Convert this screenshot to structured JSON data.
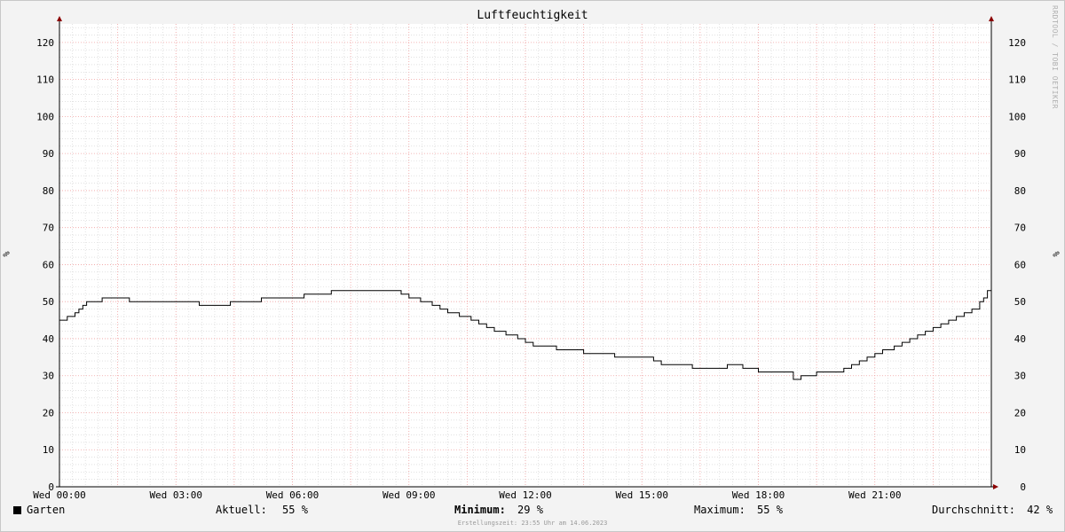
{
  "chart_data": {
    "type": "line",
    "title": "Luftfeuchtigkeit",
    "ylabel": "%",
    "ylim": [
      0,
      125
    ],
    "y_ticks": [
      0,
      10,
      20,
      30,
      40,
      50,
      60,
      70,
      80,
      90,
      100,
      110,
      120
    ],
    "x_range_hours": [
      0,
      24
    ],
    "x_tick_labels": [
      {
        "hour": 0,
        "label": "Wed 00:00"
      },
      {
        "hour": 3,
        "label": "Wed 03:00"
      },
      {
        "hour": 6,
        "label": "Wed 06:00"
      },
      {
        "hour": 9,
        "label": "Wed 09:00"
      },
      {
        "hour": 12,
        "label": "Wed 12:00"
      },
      {
        "hour": 15,
        "label": "Wed 15:00"
      },
      {
        "hour": 18,
        "label": "Wed 18:00"
      },
      {
        "hour": 21,
        "label": "Wed 21:00"
      }
    ],
    "grid": true,
    "series": [
      {
        "name": "Garten",
        "color": "#000000",
        "x": [
          0,
          0.1,
          0.2,
          0.3,
          0.4,
          0.5,
          0.6,
          0.7,
          1.0,
          1.1,
          1.7,
          1.8,
          2.7,
          3.6,
          4.4,
          5.2,
          6.3,
          7.0,
          8.0,
          8.6,
          8.8,
          9.0,
          9.3,
          9.6,
          9.8,
          10.0,
          10.3,
          10.6,
          10.8,
          11.0,
          11.2,
          11.5,
          11.8,
          12.0,
          12.2,
          12.8,
          13.5,
          14.3,
          14.9,
          15.3,
          15.5,
          16.3,
          17.2,
          17.6,
          18.0,
          18.9,
          19.1,
          19.5,
          20.0,
          20.2,
          20.4,
          20.6,
          20.8,
          21.0,
          21.2,
          21.5,
          21.7,
          21.9,
          22.1,
          22.3,
          22.5,
          22.7,
          22.9,
          23.1,
          23.3,
          23.5,
          23.7,
          23.8,
          23.9,
          24.0
        ],
        "y": [
          45,
          45,
          46,
          46,
          47,
          48,
          49,
          50,
          50,
          51,
          51,
          50,
          50,
          49,
          50,
          51,
          52,
          53,
          53,
          53,
          52,
          51,
          50,
          49,
          48,
          47,
          46,
          45,
          44,
          43,
          42,
          41,
          40,
          39,
          38,
          37,
          36,
          35,
          35,
          34,
          33,
          32,
          33,
          32,
          31,
          29,
          30,
          31,
          31,
          32,
          33,
          34,
          35,
          36,
          37,
          38,
          39,
          40,
          41,
          42,
          43,
          44,
          45,
          46,
          47,
          48,
          50,
          51,
          53,
          55
        ]
      }
    ]
  },
  "legend": {
    "series_name": "Garten",
    "current_label": "Aktuell:",
    "current_value": "55 %",
    "min_label": "Minimum:",
    "min_value": "29 %",
    "max_label": "Maximum:",
    "max_value": "55 %",
    "avg_label": "Durchschnitt:",
    "avg_value": "42 %"
  },
  "watermark": "RRDTOOL / TOBI OETIKER",
  "footer": "Erstellungszeit: 23:55 Uhr am 14.06.2023",
  "colors": {
    "major_grid": "#f0a0a0",
    "minor_grid": "#d0d0d0",
    "axis": "#000000",
    "arrow": "#8b0000"
  }
}
